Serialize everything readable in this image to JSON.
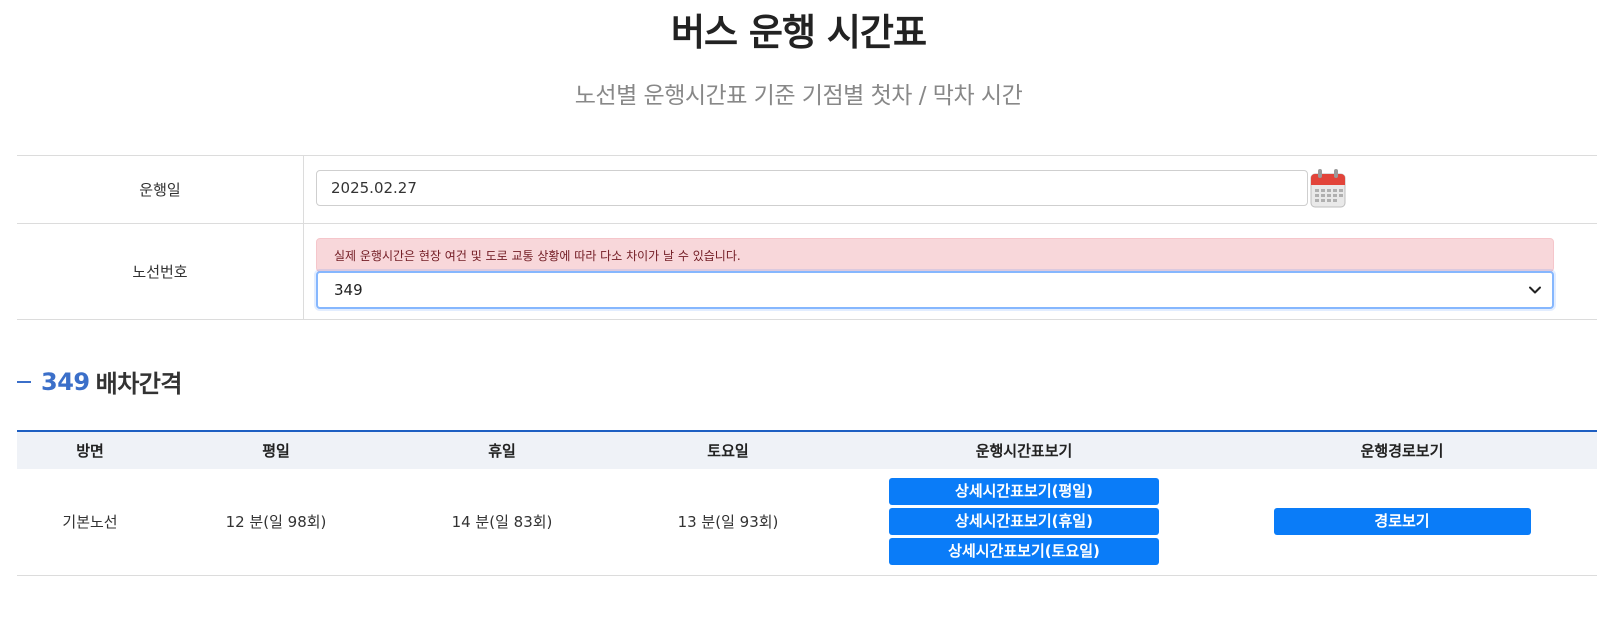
{
  "header": {
    "title": "버스 운행 시간표",
    "subtitle": "노선별 운행시간표 기준 기점별 첫차 / 막차 시간"
  },
  "form": {
    "date_label": "운행일",
    "date_value": "2025.02.27",
    "route_label": "노선번호",
    "notice": "실제 운행시간은 현장 여건 및 도로 교통 상황에 따라 다소 차이가 날 수 있습니다.",
    "route_selected": "349"
  },
  "section": {
    "route_number": "349",
    "heading_suffix": "배차간격"
  },
  "table": {
    "headers": [
      "방면",
      "평일",
      "휴일",
      "토요일",
      "운행시간표보기",
      "운행경로보기"
    ],
    "rows": [
      {
        "direction": "기본노선",
        "weekday": "12 분(일 98회)",
        "holiday": "14 분(일 83회)",
        "saturday": "13 분(일 93회)",
        "schedule_buttons": [
          "상세시간표보기(평일)",
          "상세시간표보기(휴일)",
          "상세시간표보기(토요일)"
        ],
        "route_button": "경로보기"
      }
    ]
  },
  "colors": {
    "accent": "#3b6fc9",
    "button": "#0a7cf8",
    "alert_bg": "#f8d7da",
    "header_row_bg": "#eff2f7"
  },
  "icons": [
    "calendar-icon",
    "chevron-down-icon"
  ]
}
